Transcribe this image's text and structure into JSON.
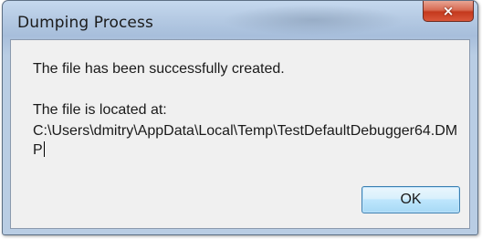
{
  "dialog": {
    "title": "Dumping Process",
    "close_icon": "×",
    "message_line1": "The file has been successfully created.",
    "message_line2": "The file is located at:",
    "file_path": "C:\\Users\\dmitry\\AppData\\Local\\Temp\\TestDefaultDebugger64.DMP",
    "ok_label": "OK"
  },
  "colors": {
    "frame": "#b6cbe4",
    "client": "#f0f0f0",
    "close_button": "#c4391d",
    "ok_border": "#3c7fb1"
  }
}
